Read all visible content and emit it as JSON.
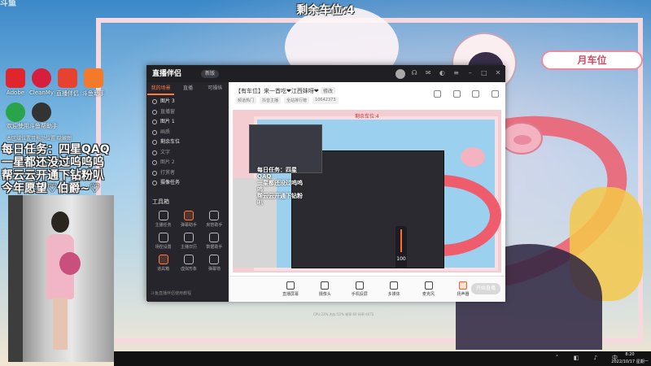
{
  "overlay": {
    "corner_logo": "斗鱼",
    "remaining_slots": "剩余车位:4",
    "top_right_tag": "月车位"
  },
  "desktop_icons": [
    {
      "label": "Adobe",
      "color": "#e0262c"
    },
    {
      "label": "CleanMyPC",
      "color": "#d61f3c"
    },
    {
      "label": "直播伴侣",
      "color": "#e7422f"
    },
    {
      "label": "斗鱼助手",
      "color": "#f47a2a"
    },
    {
      "label": "",
      "color": "#2aa44a"
    },
    {
      "label": "",
      "color": "#7a7a7a"
    }
  ],
  "welcome": {
    "line1": "欢迎使用斗鱼帮助手",
    "line2": "本区域位置可拖动位置  隐藏图"
  },
  "tasks": [
    "每日任务：四星QAQ",
    "一星都还没过呜呜呜",
    "帮云云开通下钻粉叭",
    "今年愿望♡伯爵~♡"
  ],
  "app": {
    "logo": "直播伴侣",
    "version": "新版",
    "left_tabs": [
      "我的场景",
      "直播",
      "可操纵"
    ],
    "sources": [
      {
        "label": "图片 3",
        "on": true
      },
      {
        "label": "直播窗",
        "on": false
      },
      {
        "label": "图片 1",
        "on": true
      },
      {
        "label": "画质",
        "on": false
      },
      {
        "label": "剩余车位",
        "on": true
      },
      {
        "label": "文字",
        "on": false
      },
      {
        "label": "图片 2",
        "on": false
      },
      {
        "label": "打赏者",
        "on": false
      },
      {
        "label": "摄像任务",
        "on": true
      }
    ],
    "tools_title": "工具箱",
    "tools": [
      {
        "label": "主播任务",
        "hot": false
      },
      {
        "label": "弹幕助手",
        "hot": true
      },
      {
        "label": "房管助手",
        "hot": false
      },
      {
        "label": "场控设置",
        "hot": false
      },
      {
        "label": "主播日历",
        "hot": false
      },
      {
        "label": "数据助手",
        "hot": false
      },
      {
        "label": "道具箱",
        "hot": true
      },
      {
        "label": "虚拟形象",
        "hot": false
      },
      {
        "label": "弹幕墙",
        "hot": false
      }
    ],
    "left_footer": "斗鱼直播伴侣使用教程",
    "room_title": "【有车位】来一首吃❤江西妹呀❤",
    "room_tag": "修改",
    "room_meta": [
      "频道热门",
      "抖音主播",
      "全站排行榜",
      "10642373"
    ],
    "bottom_items": [
      {
        "label": "直播屏幕",
        "hot": false
      },
      {
        "label": "摄像头",
        "hot": false
      },
      {
        "label": "手机投屏",
        "hot": false
      },
      {
        "label": "多媒体",
        "hot": false
      },
      {
        "label": "麦克风",
        "hot": false
      },
      {
        "label": "扬声器",
        "hot": true
      }
    ],
    "volume": "100",
    "go_live": "开始直播",
    "status": "CPU:23%  内存:52%  帧率:60  码率:4072"
  },
  "preview": {
    "remaining": "剩余车位:4"
  },
  "taskbar": {
    "time": "8:20",
    "date": "2022/10/17 星期一",
    "tray_icons": [
      "chevron-up-icon",
      "network-icon",
      "volume-icon",
      "ime-icon"
    ]
  }
}
